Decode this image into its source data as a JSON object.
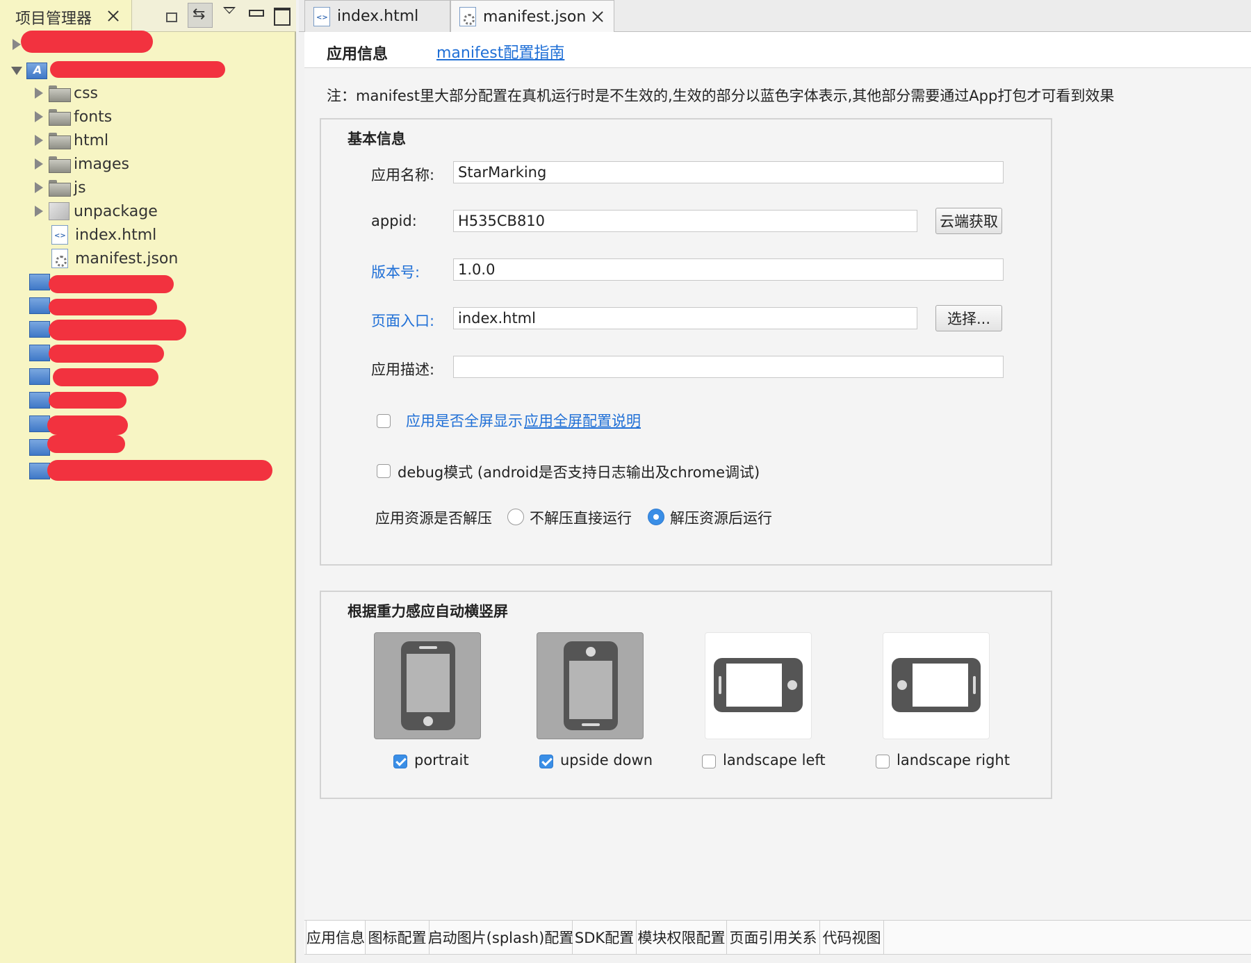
{
  "left_panel": {
    "title": "项目管理器",
    "link_icon_glyph": "⇆",
    "tree": [
      {
        "label": "css"
      },
      {
        "label": "fonts"
      },
      {
        "label": "html"
      },
      {
        "label": "images"
      },
      {
        "label": "js"
      },
      {
        "label": "unpackage"
      },
      {
        "label": "index.html"
      },
      {
        "label": "manifest.json"
      }
    ]
  },
  "editor_tabs": [
    {
      "label": "index.html"
    },
    {
      "label": "manifest.json"
    }
  ],
  "subheader": {
    "title": "应用信息",
    "link": "manifest配置指南"
  },
  "note": "注：manifest里大部分配置在真机运行时是不生效的,生效的部分以蓝色字体表示,其他部分需要通过App打包才可看到效果",
  "basic": {
    "title": "基本信息",
    "fields": {
      "name": {
        "label": "应用名称:",
        "value": "StarMarking"
      },
      "appid": {
        "label": "appid:",
        "value": "H535CB810",
        "button": "云端获取"
      },
      "version": {
        "label": "版本号:",
        "value": "1.0.0"
      },
      "entry": {
        "label": "页面入口:",
        "value": "index.html",
        "button": "选择..."
      },
      "desc": {
        "label": "应用描述:",
        "value": ""
      }
    },
    "fullscreen": {
      "label": "应用是否全屏显示",
      "link": "应用全屏配置说明",
      "checked": false
    },
    "debug": {
      "label": "debug模式 (android是否支持日志输出及chrome调试)",
      "checked": false
    },
    "unpack": {
      "label": "应用资源是否解压",
      "options": [
        "不解压直接运行",
        "解压资源后运行"
      ],
      "selected": "解压资源后运行"
    }
  },
  "orientation": {
    "title": "根据重力感应自动横竖屏",
    "options": [
      {
        "label": "portrait",
        "checked": true
      },
      {
        "label": "upside down",
        "checked": true
      },
      {
        "label": "landscape left",
        "checked": false
      },
      {
        "label": "landscape right",
        "checked": false
      }
    ]
  },
  "bottom_tabs": [
    "应用信息",
    "图标配置",
    "启动图片(splash)配置",
    "SDK配置",
    "模块权限配置",
    "页面引用关系",
    "代码视图"
  ],
  "colors": {
    "accent_blue": "#1f6fd6",
    "checkbox_blue": "#3a8ee6",
    "panel_yellow": "#f7f5c4",
    "redaction_red": "#f2323f"
  }
}
